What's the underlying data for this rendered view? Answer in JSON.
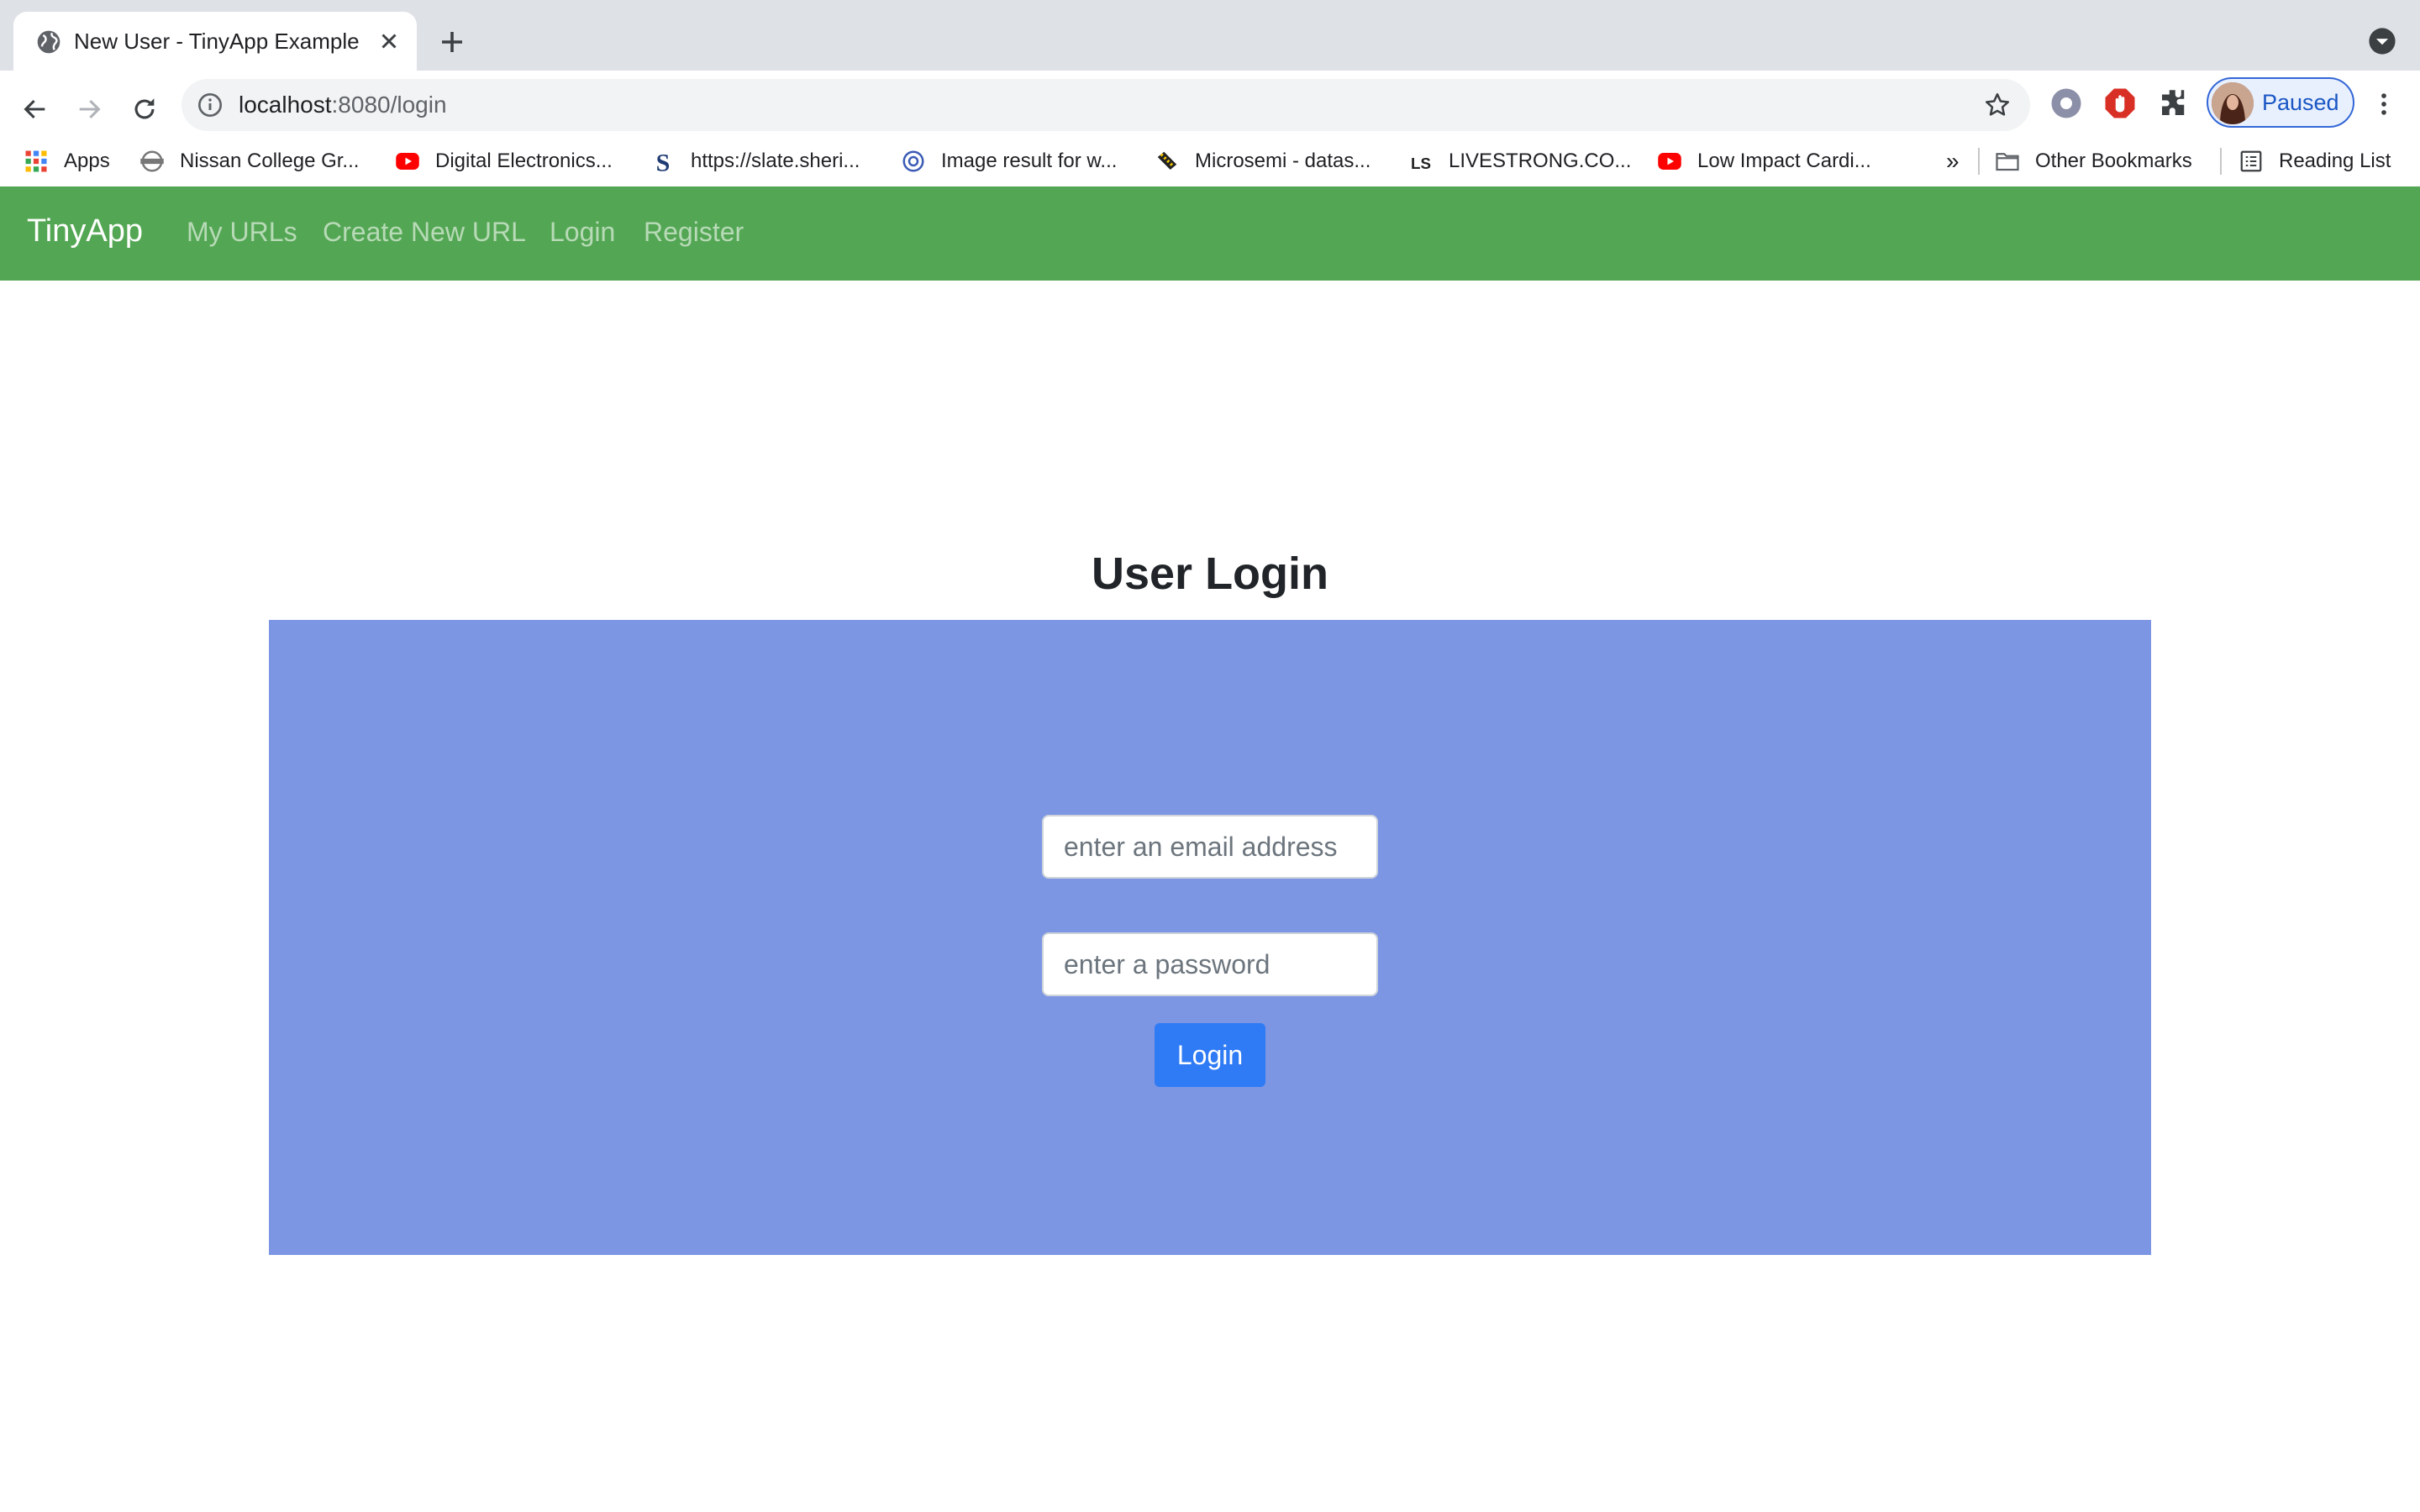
{
  "browser": {
    "tab_title": "New User - TinyApp Example",
    "url_host": "localhost",
    "url_rest": ":8080/login",
    "profile_label": "Paused",
    "bookmarks": [
      {
        "label": "Apps",
        "icon": "apps-grid-icon"
      },
      {
        "label": "Nissan College Gr...",
        "icon": "nissan-logo-icon"
      },
      {
        "label": "Digital Electronics...",
        "icon": "youtube-icon"
      },
      {
        "label": "https://slate.sheri...",
        "icon": "slate-s-icon"
      },
      {
        "label": "Image result for w...",
        "icon": "image-result-icon"
      },
      {
        "label": "Microsemi - datas...",
        "icon": "microsemi-icon"
      },
      {
        "label": "LIVESTRONG.CO...",
        "icon": "livestrong-icon"
      },
      {
        "label": "Low Impact Cardi...",
        "icon": "youtube-icon"
      }
    ],
    "overflow_label": "»",
    "other_bookmarks": "Other Bookmarks",
    "reading_list": "Reading List"
  },
  "navbar": {
    "brand": "TinyApp",
    "links": [
      "My URLs",
      "Create New URL",
      "Login",
      "Register"
    ]
  },
  "main": {
    "heading": "User Login",
    "email_placeholder": "enter an email address",
    "password_placeholder": "enter a password",
    "submit_label": "Login"
  },
  "colors": {
    "navbar": "#53a653",
    "panel": "#7c96e3",
    "button": "#2f7bf5"
  }
}
